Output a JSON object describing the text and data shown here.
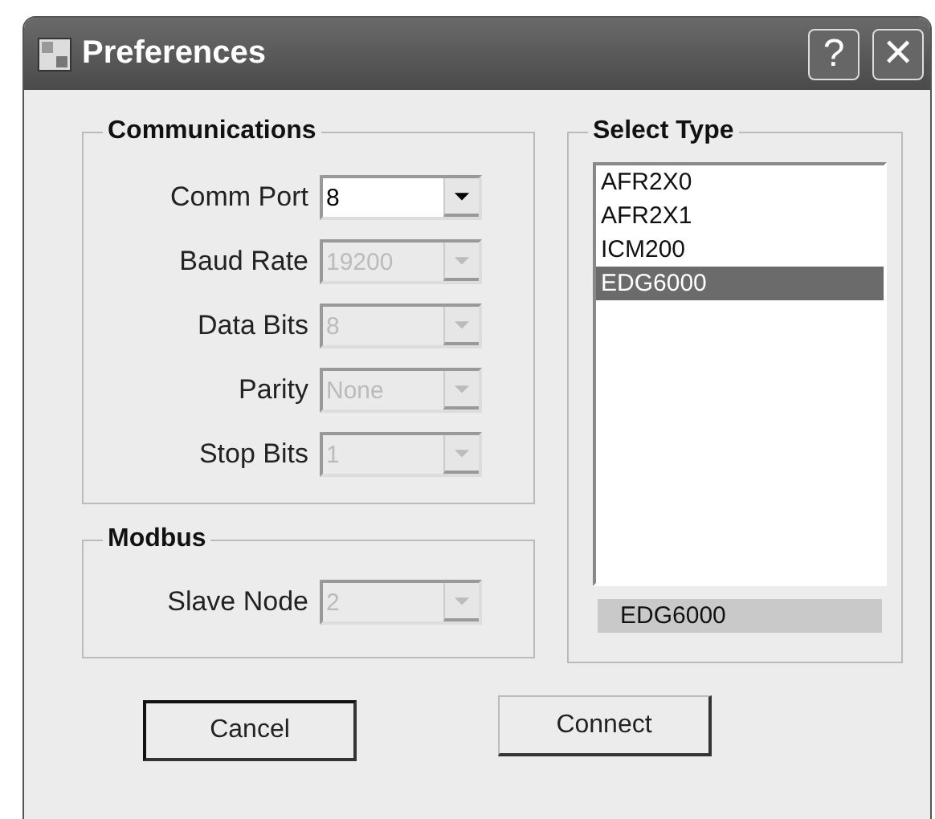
{
  "window": {
    "title": "Preferences",
    "buttons": [
      "?",
      "✕"
    ]
  },
  "communications": {
    "title": "Communications",
    "fields": [
      {
        "label": "Comm Port",
        "value": "8",
        "disabled": false
      },
      {
        "label": "Baud Rate",
        "value": "19200",
        "disabled": true
      },
      {
        "label": "Data Bits",
        "value": "8",
        "disabled": true
      },
      {
        "label": "Parity",
        "value": "None",
        "disabled": true
      },
      {
        "label": "Stop Bits",
        "value": "1",
        "disabled": true
      }
    ]
  },
  "modbus": {
    "title": "Modbus",
    "fields": [
      {
        "label": "Slave Node",
        "value": "2",
        "disabled": true
      }
    ]
  },
  "select_type": {
    "title": "Select Type",
    "items": [
      {
        "label": "AFR2X0",
        "selected": false
      },
      {
        "label": "AFR2X1",
        "selected": false
      },
      {
        "label": "ICM200",
        "selected": false
      },
      {
        "label": "EDG6000",
        "selected": true
      }
    ],
    "current": "EDG6000"
  },
  "buttons": [
    {
      "label": "Cancel",
      "default": true
    },
    {
      "label": "Connect",
      "default": false
    }
  ]
}
